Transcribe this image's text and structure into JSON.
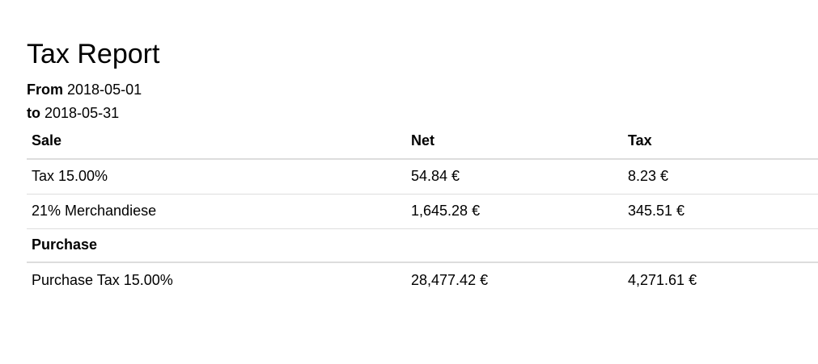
{
  "report": {
    "title": "Tax Report",
    "from_label": "From",
    "from_date": "2018-05-01",
    "to_label": "to",
    "to_date": "2018-05-31"
  },
  "table": {
    "headers": {
      "name": "Sale",
      "net": "Net",
      "tax": "Tax"
    },
    "sale_rows": [
      {
        "name": "Tax 15.00%",
        "net": "54.84 €",
        "tax": "8.23 €"
      },
      {
        "name": "21% Merchandiese",
        "net": "1,645.28 €",
        "tax": "345.51 €"
      }
    ],
    "purchase_section": "Purchase",
    "purchase_rows": [
      {
        "name": "Purchase Tax 15.00%",
        "net": "28,477.42 €",
        "tax": "4,271.61 €"
      }
    ]
  }
}
